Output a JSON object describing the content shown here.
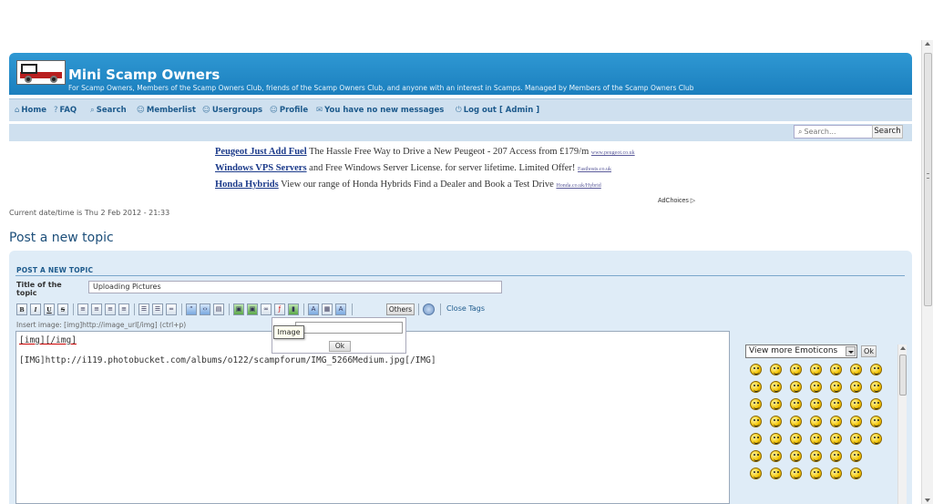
{
  "header": {
    "title": "Mini Scamp Owners",
    "description": "For Scamp Owners, Members of the Scamp Owners Club, friends of the Scamp Owners Club, and anyone with an interest in Scamps. Managed by Members of the Scamp Owners Club"
  },
  "nav": {
    "home": "Home",
    "faq": "FAQ",
    "search": "Search",
    "memberlist": "Memberlist",
    "usergroups": "Usergroups",
    "profile": "Profile",
    "messages": "You have no new messages",
    "logout": "Log out [ Admin ]"
  },
  "search": {
    "placeholder": "Search...",
    "button": "Search"
  },
  "ads": [
    {
      "title": "Peugeot Just Add Fuel",
      "text": " The Hassle Free Way to Drive a New Peugeot - 207 Access from £179/m ",
      "url": "www.peugeot.co.uk"
    },
    {
      "title": "Windows VPS Servers",
      "text": " and Free Windows Server License. for server lifetime. Limited Offer! ",
      "url": "Fasthosts.co.uk"
    },
    {
      "title": "Honda Hybrids",
      "text": " View our range of Honda Hybrids Find a Dealer and Book a Test Drive ",
      "url": "Honda.co.uk/Hybrid"
    }
  ],
  "adchoices": "AdChoices ▷",
  "datetime": "Current date/time is Thu 2 Feb 2012 - 21:33",
  "page_heading": "Post a new topic",
  "form": {
    "panel_title": "POST A NEW TOPIC",
    "title_label": "Title of the topic",
    "title_value": "Uploading Pictures",
    "toolbar": {
      "bold": "B",
      "italic": "I",
      "underline": "U",
      "strike": "S",
      "others": "Others",
      "close_tags": "Close Tags"
    },
    "insert_hint": "Insert image: [img]http://image_url[/img] (ctrl+p)",
    "message_lines": [
      "[img][/img]",
      "",
      "[IMG]http://i119.photobucket.com/albums/o122/scampforum/IMG_5266Medium.jpg[/IMG]"
    ],
    "popup": {
      "ok": "Ok",
      "tooltip": "Image"
    },
    "emoticons": {
      "select_value": "View more Emoticons",
      "ok": "Ok",
      "icons": [
        "smile-icon",
        "happy-icon",
        "laugh-icon",
        "wink-icon",
        "shocked-icon",
        "cool-icon",
        "grin-icon",
        "sad-icon",
        "surprised-icon",
        "blush-icon",
        "confused-icon",
        "angry-icon",
        "evil-icon",
        "tongue-icon",
        "sleepy-icon",
        "exclaim-icon",
        "question-icon",
        "idea-icon",
        "neutral-icon",
        "rolleyes-icon",
        "alien-icon",
        "star-icon",
        "eyes-icon",
        "heart-icon",
        "green-face-icon",
        "dizzy-icon",
        "silly-icon",
        "skull-icon",
        "laughing-icon",
        "joy-icon",
        "drool-icon",
        "whistle-icon",
        "frog-icon",
        "bear-icon",
        "mole-icon",
        "devil-icon",
        "nod-icon",
        "kiss-icon",
        "pirate-icon",
        "scream-icon",
        "thumbsup-icon",
        "",
        "cheers-icon",
        "dance-icon",
        "party-icon",
        "sleep-icon",
        "sun-icon",
        "hand-icon",
        ""
      ]
    }
  }
}
